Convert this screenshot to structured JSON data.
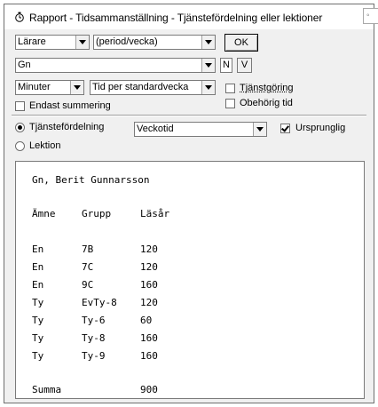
{
  "window": {
    "title": "Rapport - Tidsammanställning - Tjänstefördelning eller lektioner",
    "close_glyph": "◦"
  },
  "filters": {
    "person_type": "Lärare",
    "period": "(period/vecka)",
    "ok_label": "OK",
    "teacher": "Gn",
    "n_label": "N",
    "v_label": "V",
    "unit": "Minuter",
    "time_mode": "Tid per standardvecka",
    "tjanstgoring_label": "Tjänstgöring",
    "tjanstgoring_checked": false,
    "obehorig_label": "Obehörig tid",
    "obehorig_checked": false,
    "endast_label": "Endast summering",
    "endast_checked": false
  },
  "view": {
    "tjanstefordelning_label": "Tjänstefördelning",
    "lektion_label": "Lektion",
    "selected": "Tjänstefördelning",
    "time_type": "Veckotid",
    "ursprunglig_label": "Ursprunglig",
    "ursprunglig_checked": true
  },
  "report": {
    "heading": "Gn, Berit Gunnarsson",
    "columns": [
      "Ämne",
      "Grupp",
      "Läsår"
    ],
    "rows": [
      [
        "En",
        "7B",
        "120"
      ],
      [
        "En",
        "7C",
        "120"
      ],
      [
        "En",
        "9C",
        "160"
      ],
      [
        "Ty",
        "EvTy-8",
        "120"
      ],
      [
        "Ty",
        "Ty-6",
        "60"
      ],
      [
        "Ty",
        "Ty-8",
        "160"
      ],
      [
        "Ty",
        "Ty-9",
        "160"
      ]
    ],
    "sum_label": "Summa",
    "sum_value": "900"
  }
}
